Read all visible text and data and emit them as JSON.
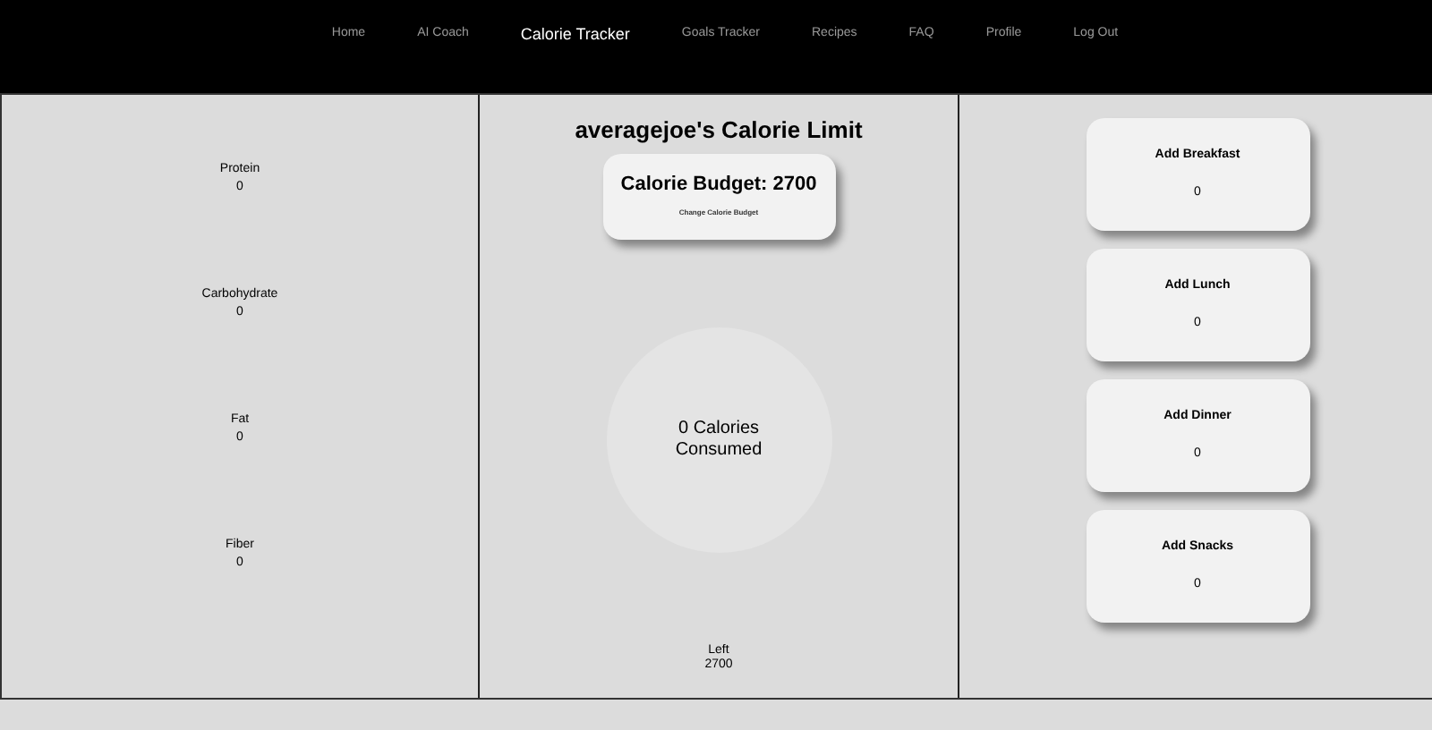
{
  "nav": [
    {
      "label": "Home",
      "selected": false
    },
    {
      "label": "AI Coach",
      "selected": false
    },
    {
      "label": "Calorie Tracker",
      "selected": true
    },
    {
      "label": "Goals Tracker",
      "selected": false
    },
    {
      "label": "Recipes",
      "selected": false
    },
    {
      "label": "FAQ",
      "selected": false
    },
    {
      "label": "Profile",
      "selected": false
    },
    {
      "label": "Log Out",
      "selected": false
    }
  ],
  "macros": [
    {
      "name": "Protein",
      "value": "0"
    },
    {
      "name": "Carbohydrate",
      "value": "0"
    },
    {
      "name": "Fat",
      "value": "0"
    },
    {
      "name": "Fiber",
      "value": "0"
    }
  ],
  "center": {
    "title": "averagejoe's Calorie Limit",
    "budget": "Calorie Budget: 2700",
    "change_button": "Change Calorie Budget",
    "consumed": "0 Calories Consumed",
    "left_label": "Left",
    "left_value": "2700"
  },
  "meals": [
    {
      "label": "Add Breakfast",
      "value": "0"
    },
    {
      "label": "Add Lunch",
      "value": "0"
    },
    {
      "label": "Add Dinner",
      "value": "0"
    },
    {
      "label": "Add Snacks",
      "value": "0"
    }
  ]
}
